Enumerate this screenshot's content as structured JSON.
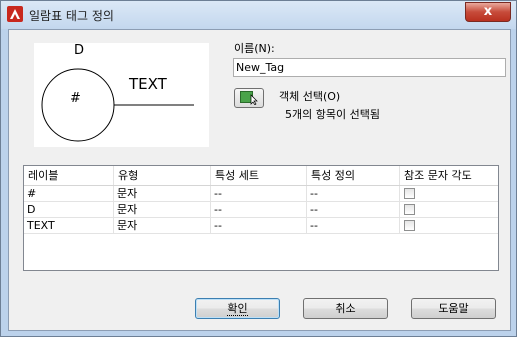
{
  "window": {
    "title": "일람표 태그 정의",
    "close_glyph": "x"
  },
  "preview": {
    "label_top": "D",
    "label_right": "TEXT",
    "label_center": "#"
  },
  "name": {
    "label": "이름(N):",
    "value": "New_Tag"
  },
  "selection": {
    "button_label": "객체 선택(O)",
    "status": "5개의 항목이 선택됨"
  },
  "table": {
    "columns": [
      "레이블",
      "유형",
      "특성 세트",
      "특성 정의",
      "참조 문자 각도"
    ],
    "rows": [
      {
        "label": "#",
        "type": "문자",
        "property_set": "--",
        "property_def": "--",
        "ref_angle": false
      },
      {
        "label": "D",
        "type": "문자",
        "property_set": "--",
        "property_def": "--",
        "ref_angle": false
      },
      {
        "label": "TEXT",
        "type": "문자",
        "property_set": "--",
        "property_def": "--",
        "ref_angle": false
      }
    ]
  },
  "buttons": {
    "ok": "확인",
    "cancel": "취소",
    "help": "도움말"
  },
  "colors": {
    "title_bar": "#c3d7ee",
    "close_button": "#c74b3a",
    "select_icon": "#4aa34a"
  }
}
